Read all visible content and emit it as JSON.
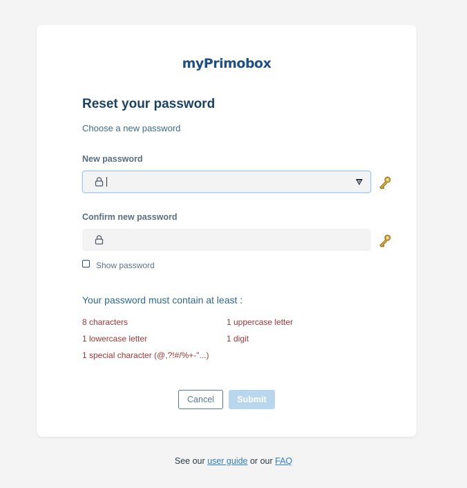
{
  "logo": {
    "text": "myPrimobox"
  },
  "form": {
    "title": "Reset your password",
    "subtitle": "Choose a new password",
    "new_password_label": "New password",
    "new_password_value": "",
    "confirm_password_label": "Confirm new password",
    "confirm_password_value": "",
    "show_password_label": "Show password",
    "show_password_checked": false
  },
  "rules": {
    "title": "Your password must contain at least :",
    "items": [
      "8 characters",
      "1 uppercase letter",
      "1 lowercase letter",
      "1 digit",
      "1 special character (@,?!#/%+-\"...)"
    ],
    "status_color": "#a13737"
  },
  "buttons": {
    "cancel": "Cancel",
    "submit": "Submit"
  },
  "footer": {
    "prefix": "See our",
    "user_guide": "user guide",
    "middle": "or our",
    "faq": "FAQ"
  },
  "icons": {
    "field_icon": "lock-icon",
    "manager_icon": "password-manager-icon",
    "generator_icon": "key-icon"
  },
  "colors": {
    "brand": "#1f4f86",
    "link": "#2f80c9",
    "submit_disabled": "#b9d7ec"
  }
}
